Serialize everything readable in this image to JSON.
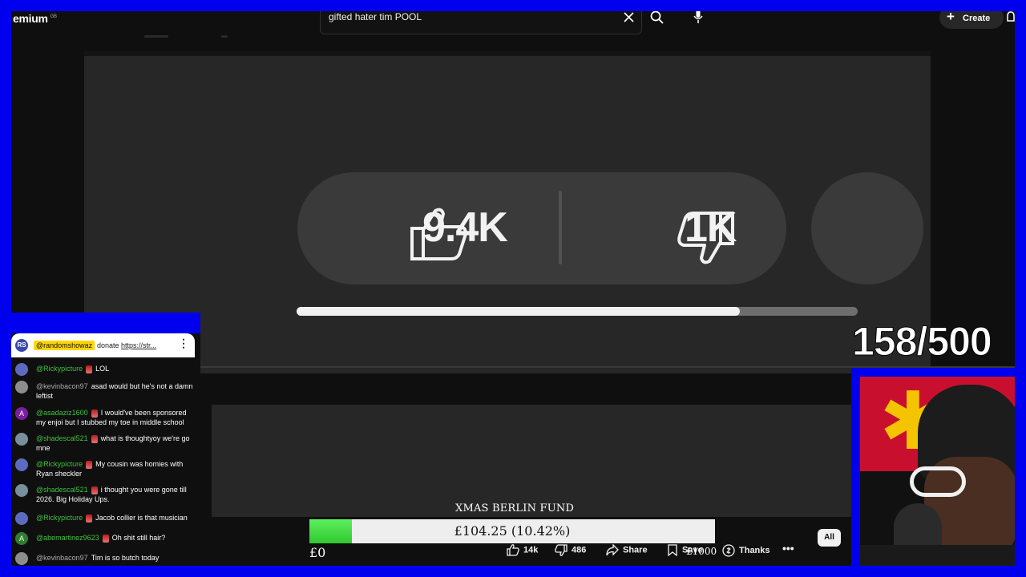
{
  "app": {
    "brand": "emium",
    "brand_sup": "GB"
  },
  "search": {
    "query": "gifted hater tim POOL"
  },
  "header": {
    "create_label": "Create"
  },
  "video": {
    "like_count": "9.4K",
    "dislike_count": "1K",
    "playback_progress": 0.79
  },
  "counter": {
    "text": "158/500"
  },
  "chat": {
    "pinned": {
      "avatar": "RS",
      "author": "@randomshowaz",
      "message_prefix": "donate ",
      "message_link": "https://str..."
    },
    "messages": [
      {
        "author": "@Rickypicture",
        "text": "LOL",
        "avatar": "",
        "color": "#5c6bc0"
      },
      {
        "author": "@kevinbacon97",
        "text": "asad would but he's not a damn leftist",
        "avatar": "",
        "color": "#8d8d8d"
      },
      {
        "author": "@asadaziz1600",
        "text": "I would've been sponsored my enjoi but I stubbed my toe in middle school",
        "avatar": "A",
        "color": "#7b1fa2"
      },
      {
        "author": "@shadescal521",
        "text": "what is thoughtyoy we're go mne",
        "avatar": "",
        "color": "#78909c"
      },
      {
        "author": "@Rickypicture",
        "text": "My cousin was homies with Ryan sheckler",
        "avatar": "",
        "color": "#5c6bc0"
      },
      {
        "author": "@shadescal521",
        "text": "i thought you were gone till 2026. Big Holiday Ups.",
        "avatar": "",
        "color": "#78909c"
      },
      {
        "author": "@Rickypicture",
        "text": "Jacob collier is that musician",
        "avatar": "",
        "color": "#5c6bc0"
      },
      {
        "author": "@abemartinez9623",
        "text": "Oh shit still hair?",
        "avatar": "A",
        "color": "#2e7d32"
      },
      {
        "author": "@kevinbacon97",
        "text": "Tim is so butch today",
        "avatar": "",
        "color": "#8d8d8d"
      }
    ]
  },
  "fund": {
    "title": "XMAS BERLIN FUND",
    "amount": "£104.25 (10.42%)",
    "fraction": 0.1042,
    "min_label": "£0",
    "max_label": "£1000"
  },
  "actions": {
    "like": "14k",
    "dislike": "486",
    "share": "Share",
    "save": "Save",
    "thanks": "Thanks",
    "all_chip": "All"
  }
}
